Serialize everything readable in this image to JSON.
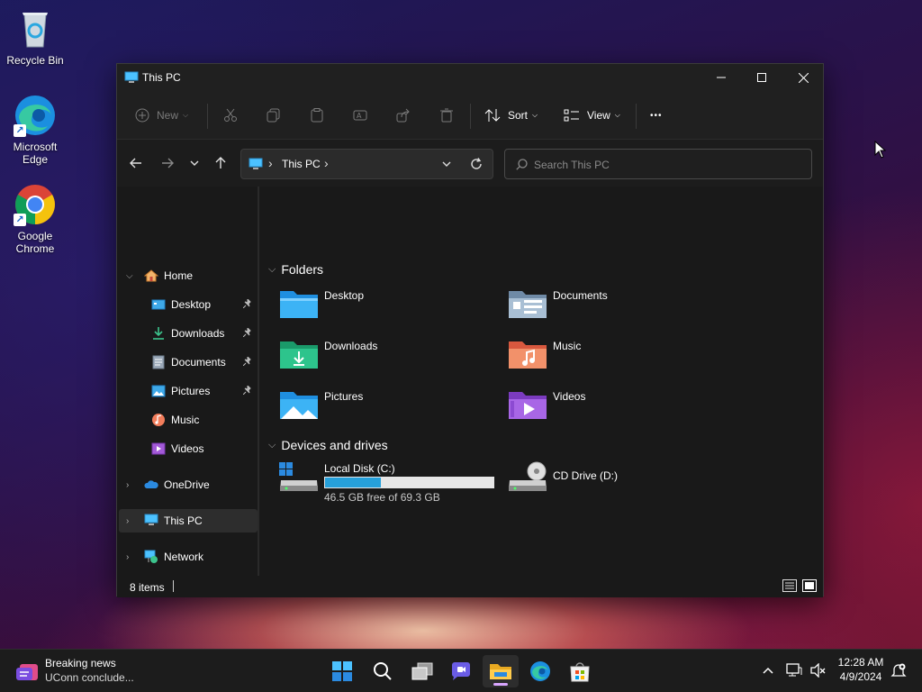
{
  "desktop": {
    "icons": [
      {
        "label": "Recycle Bin",
        "icon": "recycle-bin-icon"
      },
      {
        "label": "Microsoft Edge",
        "icon": "edge-icon"
      },
      {
        "label": "Google Chrome",
        "icon": "chrome-icon"
      }
    ]
  },
  "window": {
    "title": "This PC",
    "controls": {
      "minimize": "minimize-icon",
      "maximize": "maximize-icon",
      "close": "close-icon"
    }
  },
  "toolbar": {
    "new_label": "New",
    "sort_label": "Sort",
    "view_label": "View",
    "more_label": "•••"
  },
  "address": {
    "location": "This PC",
    "separator": "›"
  },
  "search": {
    "placeholder": "Search This PC"
  },
  "navpane": {
    "home": "Home",
    "quick_access": [
      {
        "label": "Desktop",
        "pinned": true
      },
      {
        "label": "Downloads",
        "pinned": true
      },
      {
        "label": "Documents",
        "pinned": true
      },
      {
        "label": "Pictures",
        "pinned": true
      },
      {
        "label": "Music",
        "pinned": false
      },
      {
        "label": "Videos",
        "pinned": false
      }
    ],
    "onedrive": "OneDrive",
    "this_pc": "This PC",
    "network": "Network"
  },
  "content": {
    "folders_heading": "Folders",
    "folders": [
      {
        "label": "Desktop"
      },
      {
        "label": "Documents"
      },
      {
        "label": "Downloads"
      },
      {
        "label": "Music"
      },
      {
        "label": "Pictures"
      },
      {
        "label": "Videos"
      }
    ],
    "drives_heading": "Devices and drives",
    "drives": [
      {
        "label": "Local Disk (C:)",
        "detail": "46.5 GB free of 69.3 GB",
        "used_fraction": 0.33
      },
      {
        "label": "CD Drive (D:)"
      }
    ]
  },
  "status": {
    "items": "8 items"
  },
  "taskbar": {
    "news_title": "Breaking news",
    "news_sub": "UConn conclude...",
    "time": "12:28 AM",
    "date": "4/9/2024"
  },
  "colors": {
    "accent": "#4cc2ff",
    "drive_bar": "#26a0da",
    "selected_bg": "#2d2d2d"
  }
}
